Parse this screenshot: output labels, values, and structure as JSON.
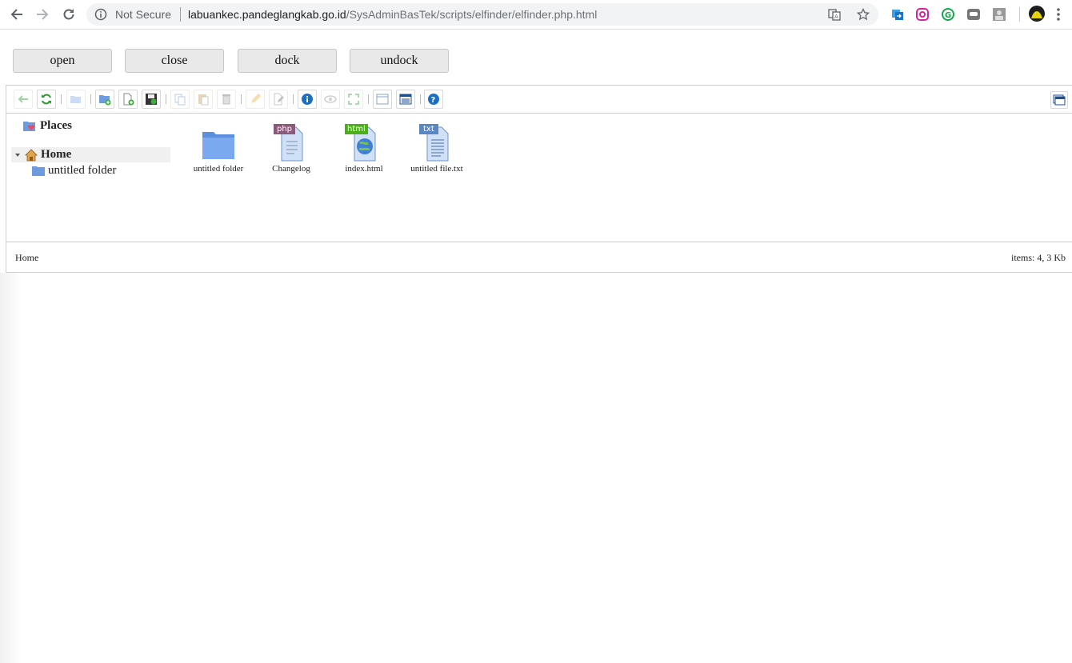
{
  "browser": {
    "security_label": "Not Secure",
    "url_host": "labuankec.pandeglangkab.go.id",
    "url_path": "/SysAdminBasTek/scripts/elfinder/elfinder.php.html",
    "icons": [
      "back-icon",
      "forward-icon",
      "reload-icon",
      "info-icon",
      "translate-icon",
      "star-icon",
      "extension-icon",
      "instagram-icon",
      "grammarly-icon",
      "line-icon",
      "profile-extension-icon",
      "avatar",
      "menu-icon"
    ]
  },
  "demo_buttons": {
    "open": "open",
    "close": "close",
    "dock": "dock",
    "undock": "undock"
  },
  "toolbar": {
    "buttons": [
      "back",
      "reload",
      "open",
      "mkdir",
      "mkfile",
      "upload",
      "copy",
      "paste",
      "rm",
      "rename",
      "edit",
      "info",
      "quicklook",
      "resize",
      "icons",
      "list",
      "help"
    ]
  },
  "tree": {
    "places": "Places",
    "home": "Home",
    "child": "untitled folder"
  },
  "files": [
    {
      "name": "untitled folder",
      "kind": "folder"
    },
    {
      "name": "Changelog",
      "kind": "php",
      "badge": "php",
      "badge_color": "#8a5a7a"
    },
    {
      "name": "index.html",
      "kind": "html",
      "badge": "html",
      "badge_color": "#4caf1a"
    },
    {
      "name": "untitled file.txt",
      "kind": "txt",
      "badge": "txt",
      "badge_color": "#5a86c4"
    }
  ],
  "status": {
    "path": "Home",
    "size": "items: 4, 3 Kb"
  }
}
